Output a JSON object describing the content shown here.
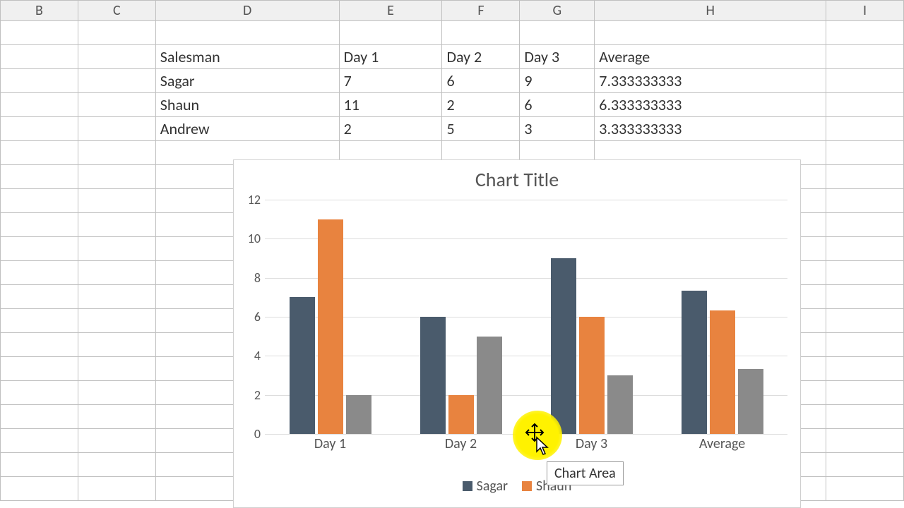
{
  "columns": {
    "B": "B",
    "C": "C",
    "D": "D",
    "E": "E",
    "F": "F",
    "G": "G",
    "H": "H",
    "I": "I"
  },
  "table": {
    "header": {
      "salesman": "Salesman",
      "d1": "Day 1",
      "d2": "Day 2",
      "d3": "Day 3",
      "avg": "Average"
    },
    "rows": [
      {
        "name": "Sagar",
        "d1": "7",
        "d2": "6",
        "d3": "9",
        "avg": "7.333333333"
      },
      {
        "name": "Shaun",
        "d1": "11",
        "d2": "2",
        "d3": "6",
        "avg": "6.333333333"
      },
      {
        "name": "Andrew",
        "d1": "2",
        "d2": "5",
        "d3": "3",
        "avg": "3.333333333"
      }
    ]
  },
  "chart_data": {
    "type": "bar",
    "title": "Chart Title",
    "categories": [
      "Day 1",
      "Day 2",
      "Day 3",
      "Average"
    ],
    "series": [
      {
        "name": "Sagar",
        "values": [
          7,
          6,
          9,
          7.333333333
        ],
        "color": "#4a5b6c"
      },
      {
        "name": "Shaun",
        "values": [
          11,
          2,
          6,
          6.333333333
        ],
        "color": "#e8833f"
      },
      {
        "name": "Andrew",
        "values": [
          2,
          5,
          3,
          3.333333333
        ],
        "color": "#8a8a8a"
      }
    ],
    "yticks": [
      0,
      2,
      4,
      6,
      8,
      10,
      12
    ],
    "ylim": [
      0,
      12
    ],
    "xlabel": "",
    "ylabel": ""
  },
  "tooltip_text": "Chart Area",
  "legend_visible": [
    "Sagar",
    "Shaun"
  ]
}
